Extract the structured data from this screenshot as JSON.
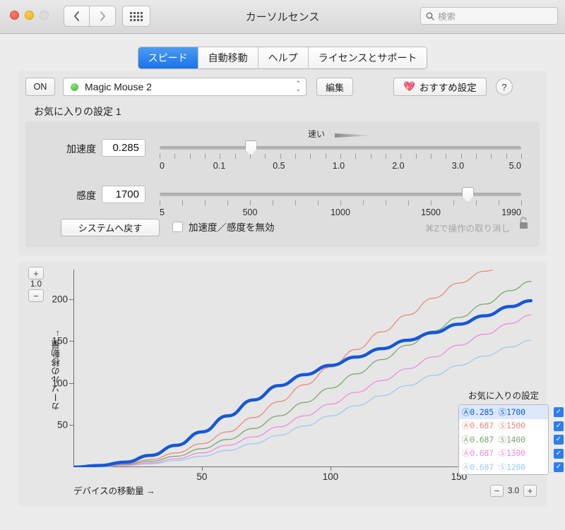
{
  "window": {
    "title": "カーソルセンス",
    "search_placeholder": "検索",
    "nav_back": "‹",
    "nav_forward": "›"
  },
  "tabs": [
    {
      "label": "スピード",
      "active": true
    },
    {
      "label": "自動移動",
      "active": false
    },
    {
      "label": "ヘルプ",
      "active": false
    },
    {
      "label": "ライセンスとサポート",
      "active": false
    }
  ],
  "toolbar": {
    "on_label": "ON",
    "device_name": "Magic Mouse 2",
    "device_status_color": "#4cc13a",
    "edit_label": "編集",
    "recommend_label": "おすすめ設定",
    "recommend_icon": "💖",
    "help_label": "?"
  },
  "favorite_label": "お気に入りの設定 1",
  "fast_label": "速い",
  "sliders": {
    "acceleration": {
      "label": "加速度",
      "value": "0.285",
      "knob_percent": 25.2,
      "tick_count": 25,
      "tick_labels": [
        "0",
        "0.1",
        "0.5",
        "1.0",
        "2.0",
        "3.0",
        "5.0"
      ],
      "tick_label_positions": [
        0,
        16.5,
        33,
        49.5,
        66,
        82.5,
        100
      ]
    },
    "sensitivity": {
      "label": "感度",
      "value": "1700",
      "knob_percent": 85.2,
      "tick_count": 17,
      "tick_labels": [
        "5",
        "500",
        "1000",
        "1500",
        "1990"
      ],
      "tick_label_positions": [
        0,
        25,
        50,
        75,
        100
      ]
    }
  },
  "footer": {
    "reset_label": "システムへ戻す",
    "disable_checkbox_label": "加速度／感度を無効",
    "disable_checked": false,
    "undo_hint": "⌘Zで操作の取り消し"
  },
  "chart_zoom": {
    "vertical_value": "1.0",
    "vertical_plus": "+",
    "vertical_minus": "−",
    "horizontal_value": "3.0",
    "horizontal_plus": "+",
    "horizontal_minus": "−"
  },
  "chart_data": {
    "type": "line",
    "title": "",
    "xlabel": "デバイスの移動量 →",
    "ylabel": "カーソルの移動量 →",
    "xlim": [
      0,
      180
    ],
    "ylim": [
      0,
      235
    ],
    "x_ticks": [
      50,
      100,
      150
    ],
    "y_ticks": [
      50,
      100,
      150,
      200
    ],
    "grid": false,
    "legend_position": "inside-bottom-right",
    "legend_title": "お気に入りの設定",
    "series": [
      {
        "name": "Ⓐ0.285 Ⓢ1700",
        "accel": "0.285",
        "sens": "1700",
        "color": "#1558d6",
        "width": 4.5,
        "selected": true,
        "checked": true,
        "x": [
          0,
          10,
          20,
          30,
          40,
          50,
          60,
          70,
          80,
          90,
          100,
          110,
          120,
          130,
          140,
          150,
          160,
          170,
          178
        ],
        "y": [
          0,
          2,
          6,
          14,
          26,
          42,
          61,
          80,
          97,
          110,
          121,
          131,
          141,
          151,
          160,
          170,
          180,
          191,
          198
        ]
      },
      {
        "name": "Ⓐ0.687 Ⓢ1500",
        "accel": "0.687",
        "sens": "1500",
        "color": "#e8897b",
        "width": 1.3,
        "selected": false,
        "checked": true,
        "x": [
          0,
          10,
          20,
          30,
          40,
          50,
          60,
          70,
          80,
          90,
          100,
          110,
          120,
          130,
          140,
          150,
          160,
          168
        ],
        "y": [
          0,
          1,
          4,
          9,
          17,
          28,
          42,
          59,
          78,
          98,
          119,
          140,
          161,
          181,
          201,
          219,
          233,
          240
        ]
      },
      {
        "name": "Ⓐ0.687 Ⓢ1400",
        "accel": "0.687",
        "sens": "1400",
        "color": "#7aa870",
        "width": 1.3,
        "selected": false,
        "checked": true,
        "x": [
          0,
          10,
          20,
          30,
          40,
          50,
          60,
          70,
          80,
          90,
          100,
          110,
          120,
          130,
          140,
          150,
          160,
          170,
          178
        ],
        "y": [
          0,
          1,
          3,
          7,
          13,
          22,
          33,
          46,
          61,
          77,
          94,
          111,
          128,
          145,
          162,
          178,
          194,
          210,
          221
        ]
      },
      {
        "name": "Ⓐ0.687 Ⓢ1300",
        "accel": "0.687",
        "sens": "1300",
        "color": "#f08ae0",
        "width": 1.3,
        "selected": false,
        "checked": true,
        "x": [
          0,
          10,
          20,
          30,
          40,
          50,
          60,
          70,
          80,
          90,
          100,
          110,
          120,
          130,
          140,
          150,
          160,
          170,
          178
        ],
        "y": [
          0,
          1,
          2,
          5,
          10,
          17,
          26,
          36,
          48,
          61,
          75,
          89,
          103,
          117,
          131,
          145,
          158,
          171,
          181
        ]
      },
      {
        "name": "Ⓐ0.687 Ⓢ1200",
        "accel": "0.687",
        "sens": "1200",
        "color": "#9ccaf0",
        "width": 1.3,
        "selected": false,
        "checked": true,
        "x": [
          0,
          10,
          20,
          30,
          40,
          50,
          60,
          70,
          80,
          90,
          100,
          110,
          120,
          130,
          140,
          150,
          160,
          170,
          178
        ],
        "y": [
          0,
          0,
          2,
          4,
          8,
          13,
          20,
          28,
          38,
          49,
          61,
          73,
          85,
          97,
          109,
          121,
          132,
          143,
          151
        ]
      }
    ]
  }
}
